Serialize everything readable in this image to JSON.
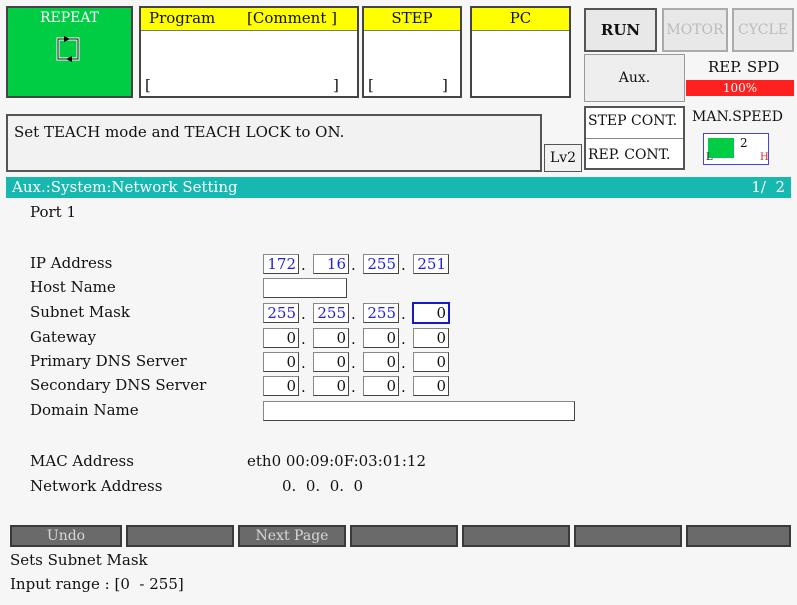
{
  "top": {
    "repeat_label": "REPEAT",
    "program_label": "Program",
    "comment_label": "[Comment ]",
    "program_bracket_left": "[",
    "program_bracket_right": "]",
    "step_label": "STEP",
    "step_bracket_left": "[",
    "step_bracket_right": "]",
    "pc_label": "PC",
    "run_label": "RUN",
    "motor_label": "MOTOR",
    "cycle_label": "CYCLE",
    "aux_label": "Aux.",
    "rep_spd_label": "REP. SPD",
    "rep_spd_value": "100%",
    "step_cont_label": "STEP CONT.",
    "rep_cont_label": "REP. CONT.",
    "man_speed_label": "MAN.SPEED",
    "man_speed_value": "2",
    "man_speed_low": "L",
    "man_speed_high": "H",
    "message": "Set TEACH mode and TEACH LOCK to ON.",
    "level": "Lv2"
  },
  "title_bar": {
    "path": "Aux.:System:Network Setting",
    "page_indicator": "1/  2"
  },
  "form": {
    "port": "Port 1",
    "ip_label": "IP Address",
    "ip": [
      "172",
      "16",
      "255",
      "251"
    ],
    "host_label": "Host Name",
    "host_value": "",
    "subnet_label": "Subnet Mask",
    "subnet": [
      "255",
      "255",
      "255",
      "0"
    ],
    "gateway_label": "Gateway",
    "gateway": [
      "0",
      "0",
      "0",
      "0"
    ],
    "dns1_label": "Primary DNS Server",
    "dns1": [
      "0",
      "0",
      "0",
      "0"
    ],
    "dns2_label": "Secondary DNS Server",
    "dns2": [
      "0",
      "0",
      "0",
      "0"
    ],
    "domain_label": "Domain Name",
    "domain_value": "",
    "mac_label": "MAC Address",
    "mac_value": "eth0 00:09:0F:03:01:12",
    "netaddr_label": "Network Address",
    "netaddr_value": "0.  0.  0.  0"
  },
  "fkeys": {
    "undo": "Undo",
    "next_page": "Next Page"
  },
  "help": {
    "line1": "Sets Subnet Mask",
    "line2": "Input range : [0  - 255]"
  },
  "colors": {
    "repeat_bg": "#00cc44",
    "header_yellow": "#ffff00",
    "title_teal": "#16b8b0",
    "speed_red": "#ff2020",
    "field_blue": "#2222dd"
  }
}
